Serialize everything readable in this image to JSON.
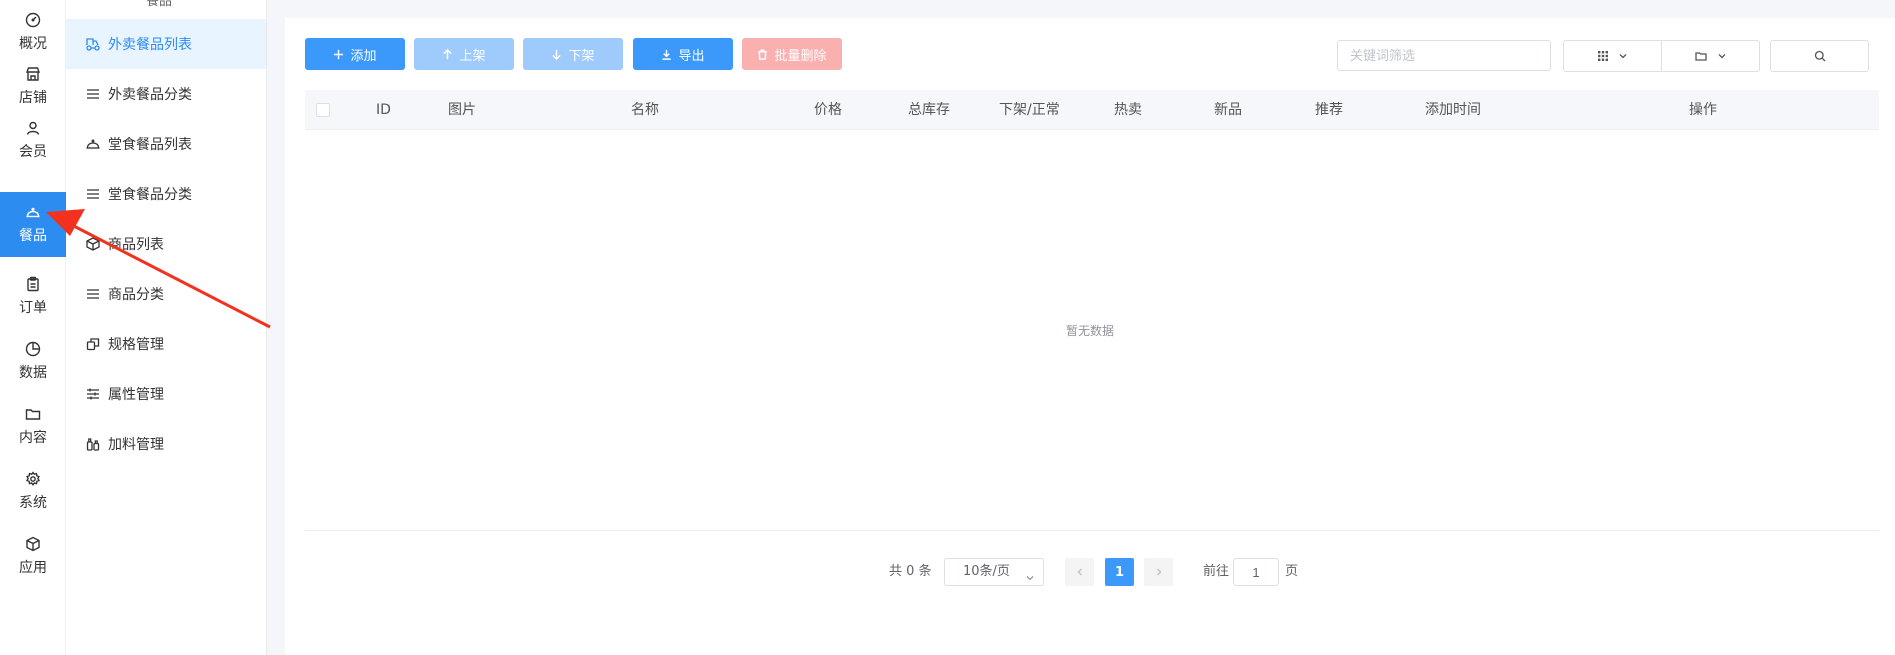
{
  "rail": {
    "items": [
      {
        "label": "概况",
        "icon": "dashboard-icon"
      },
      {
        "label": "店铺",
        "icon": "store-icon"
      },
      {
        "label": "会员",
        "icon": "user-icon"
      },
      {
        "label": "餐品",
        "icon": "cloche-icon",
        "active": true
      },
      {
        "label": "订单",
        "icon": "clipboard-icon"
      },
      {
        "label": "数据",
        "icon": "pie-chart-icon"
      },
      {
        "label": "内容",
        "icon": "folder-icon"
      },
      {
        "label": "系统",
        "icon": "gear-icon"
      },
      {
        "label": "应用",
        "icon": "cube-icon"
      }
    ]
  },
  "submenu": {
    "header": "餐品",
    "items": [
      {
        "label": "外卖餐品列表",
        "icon": "delivery-icon",
        "active": true
      },
      {
        "label": "外卖餐品分类",
        "icon": "list-icon"
      },
      {
        "label": "堂食餐品列表",
        "icon": "cloche-icon"
      },
      {
        "label": "堂食餐品分类",
        "icon": "list-icon"
      },
      {
        "label": "商品列表",
        "icon": "box-icon"
      },
      {
        "label": "商品分类",
        "icon": "list-icon"
      },
      {
        "label": "规格管理",
        "icon": "copy-icon"
      },
      {
        "label": "属性管理",
        "icon": "sliders-icon"
      },
      {
        "label": "加料管理",
        "icon": "bottle-icon"
      }
    ]
  },
  "toolbar": {
    "add_label": "添加",
    "up_label": "上架",
    "down_label": "下架",
    "export_label": "导出",
    "batch_delete_label": "批量删除",
    "search_placeholder": "关键词筛选"
  },
  "table": {
    "columns": [
      "ID",
      "图片",
      "名称",
      "价格",
      "总库存",
      "下架/正常",
      "热卖",
      "新品",
      "推荐",
      "添加时间",
      "操作"
    ],
    "rows": [],
    "empty_text": "暂无数据"
  },
  "pagination": {
    "total_text": "共 0 条",
    "page_size": "10条/页",
    "current_page": "1",
    "goto_label": "前往",
    "goto_value": "1",
    "page_suffix": "页"
  },
  "colors": {
    "primary": "#3b99fc",
    "primary_disabled": "#9ecbfb",
    "danger_disabled": "#fbb0b0",
    "annotation_arrow": "#f2321f"
  }
}
